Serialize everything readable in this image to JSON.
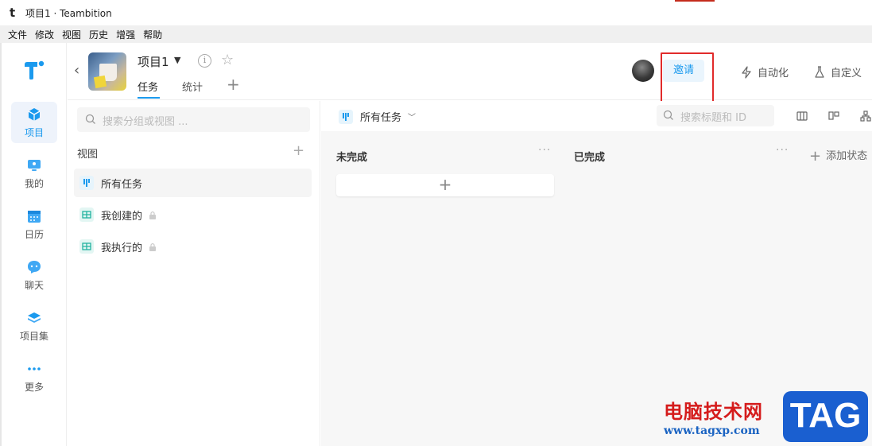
{
  "window": {
    "title": "项目1 · Teambition",
    "logo_letter": "t"
  },
  "menubar": [
    "文件",
    "修改",
    "视图",
    "历史",
    "增强",
    "帮助"
  ],
  "rail": {
    "items": [
      {
        "label": "项目",
        "icon": "cube-icon",
        "active": true
      },
      {
        "label": "我的",
        "icon": "monitor-icon"
      },
      {
        "label": "日历",
        "icon": "calendar-icon"
      },
      {
        "label": "聊天",
        "icon": "chat-icon"
      },
      {
        "label": "项目集",
        "icon": "layers-icon"
      },
      {
        "label": "更多",
        "icon": "more-dots-icon"
      }
    ]
  },
  "header": {
    "project_name": "项目1",
    "tabs": [
      "任务",
      "统计"
    ],
    "invite_label": "邀请",
    "automation_label": "自动化",
    "customize_label": "自定义"
  },
  "sidepanel": {
    "search_placeholder": "搜索分组或视图 ...",
    "views_title": "视图",
    "views": [
      {
        "label": "所有任务",
        "active": true
      },
      {
        "label": "我创建的",
        "locked": true
      },
      {
        "label": "我执行的",
        "locked": true
      }
    ]
  },
  "main": {
    "current_view": "所有任务",
    "search_placeholder": "搜索标题和 ID",
    "columns": [
      "未完成",
      "已完成"
    ],
    "add_status_label": "添加状态"
  },
  "watermark": {
    "cn": "电脑技术网",
    "url": "www.tagxp.com",
    "tag": "TAG"
  },
  "colors": {
    "accent": "#1b9aee",
    "highlight": "#e12b2b",
    "view_icon_bg": "#e6f4fc"
  }
}
